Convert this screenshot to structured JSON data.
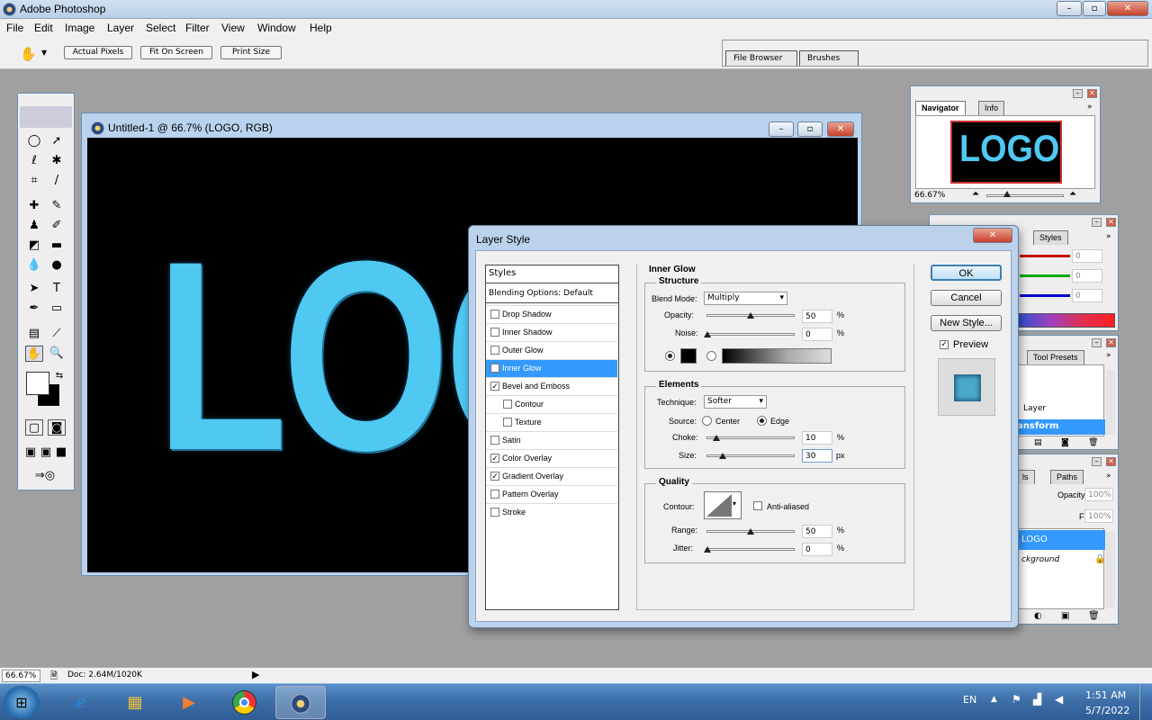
{
  "app": {
    "title": "Adobe Photoshop"
  },
  "menu": [
    "File",
    "Edit",
    "Image",
    "Layer",
    "Select",
    "Filter",
    "View",
    "Window",
    "Help"
  ],
  "options": {
    "buttons": [
      "Actual Pixels",
      "Fit On Screen",
      "Print Size"
    ]
  },
  "well": {
    "tabs": [
      "File Browser",
      "Brushes"
    ]
  },
  "document": {
    "title": "Untitled-1 @ 66.7% (LOGO, RGB)",
    "art_text": "LOGO"
  },
  "navigator": {
    "tabs": [
      "Navigator",
      "Info"
    ],
    "preview_text": "LOGO",
    "zoom": "66.67%"
  },
  "color_panel": {
    "tab": "Styles",
    "values": [
      "0",
      "0",
      "0"
    ]
  },
  "history_panel": {
    "tab": "Tool Presets",
    "items": [
      "Layer",
      "ansform"
    ]
  },
  "layers_panel": {
    "tabs": [
      "ls",
      "Paths"
    ],
    "opacity_label": "Opacity:",
    "opacity": "100%",
    "fill_label": "Fill:",
    "fill": "100%",
    "layers": [
      "LOGO",
      "ckground"
    ]
  },
  "dialog": {
    "title": "Layer Style",
    "styles_header": "Styles",
    "blending": "Blending Options: Default",
    "style_items": [
      {
        "label": "Drop Shadow",
        "checked": false
      },
      {
        "label": "Inner Shadow",
        "checked": false
      },
      {
        "label": "Outer Glow",
        "checked": false
      },
      {
        "label": "Inner Glow",
        "checked": true
      },
      {
        "label": "Bevel and Emboss",
        "checked": true
      },
      {
        "label": "Contour",
        "checked": false
      },
      {
        "label": "Texture",
        "checked": false
      },
      {
        "label": "Satin",
        "checked": false
      },
      {
        "label": "Color Overlay",
        "checked": true
      },
      {
        "label": "Gradient Overlay",
        "checked": true
      },
      {
        "label": "Pattern Overlay",
        "checked": false
      },
      {
        "label": "Stroke",
        "checked": false
      }
    ],
    "section_title": "Inner Glow",
    "structure": {
      "title": "Structure",
      "blend_label": "Blend Mode:",
      "blend_mode": "Multiply",
      "opacity_label": "Opacity:",
      "opacity": "50",
      "noise_label": "Noise:",
      "noise": "0",
      "unit": "%"
    },
    "elements": {
      "title": "Elements",
      "technique_label": "Technique:",
      "technique": "Softer",
      "source_label": "Source:",
      "source_center": "Center",
      "source_edge": "Edge",
      "choke_label": "Choke:",
      "choke": "10",
      "size_label": "Size:",
      "size": "30",
      "px": "px"
    },
    "quality": {
      "title": "Quality",
      "contour_label": "Contour:",
      "anti_aliased": "Anti-aliased",
      "range_label": "Range:",
      "range": "50",
      "jitter_label": "Jitter:",
      "jitter": "0"
    },
    "buttons": {
      "ok": "OK",
      "cancel": "Cancel",
      "new_style": "New Style...",
      "preview": "Preview"
    }
  },
  "status": {
    "zoom": "66.67%",
    "doc": "Doc: 2.64M/1020K"
  },
  "taskbar": {
    "lang": "EN",
    "time": "1:51 AM",
    "date": "5/7/2022"
  }
}
